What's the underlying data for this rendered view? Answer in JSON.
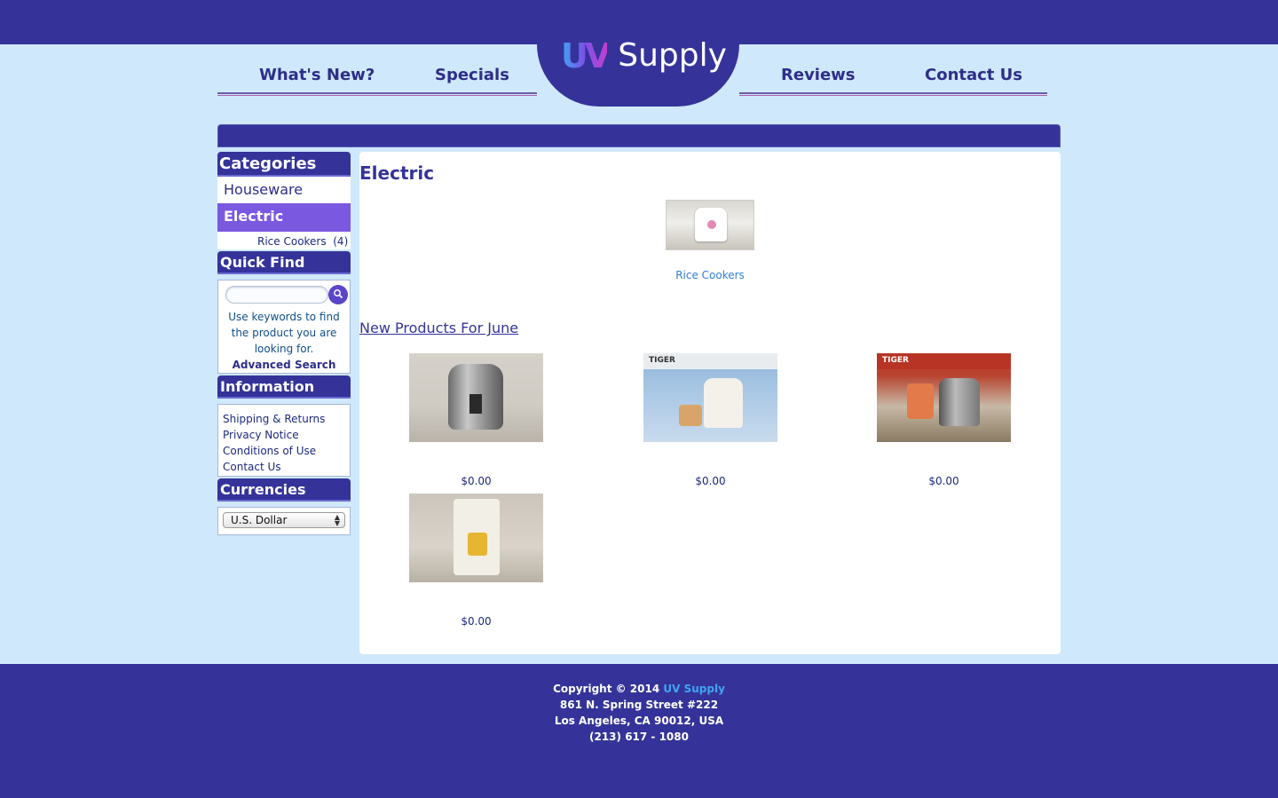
{
  "site": {
    "logo_uv": "UV",
    "logo_text": "Supply"
  },
  "nav": {
    "whats_new": "What's New?",
    "specials": "Specials",
    "reviews": "Reviews",
    "contact": "Contact Us"
  },
  "sidebar": {
    "categories_title": "Categories",
    "categories": [
      {
        "label": "Houseware",
        "active": false
      },
      {
        "label": "Electric",
        "active": true
      }
    ],
    "subcategory": "Rice Cookers  (4)",
    "quick_find_title": "Quick Find",
    "quick_find_text": "Use keywords to find the product you are looking for.",
    "advanced_search": "Advanced Search",
    "information_title": "Information",
    "information_links": [
      "Shipping & Returns",
      "Privacy Notice",
      "Conditions of Use",
      "Contact Us"
    ],
    "currencies_title": "Currencies",
    "currency_selected": "U.S. Dollar"
  },
  "main": {
    "title": "Electric",
    "category_tile": "Rice Cookers",
    "new_products_title": "New Products For June",
    "products": [
      {
        "price": "$0.00"
      },
      {
        "price": "$0.00"
      },
      {
        "price": "$0.00"
      },
      {
        "price": "$0.00"
      }
    ],
    "box_brand": "TIGER"
  },
  "footer": {
    "copyright_prefix": "Copyright © 2014",
    "copyright_link": "UV Supply",
    "address1": "861 N. Spring Street #222",
    "address2": "Los Angeles, CA 90012, USA",
    "phone": "(213) 617 - 1080"
  },
  "colors": {
    "primary": "#35339a",
    "background": "#cfe8fb",
    "active_category": "#7b58e0",
    "link_blue": "#2f7fd9"
  }
}
